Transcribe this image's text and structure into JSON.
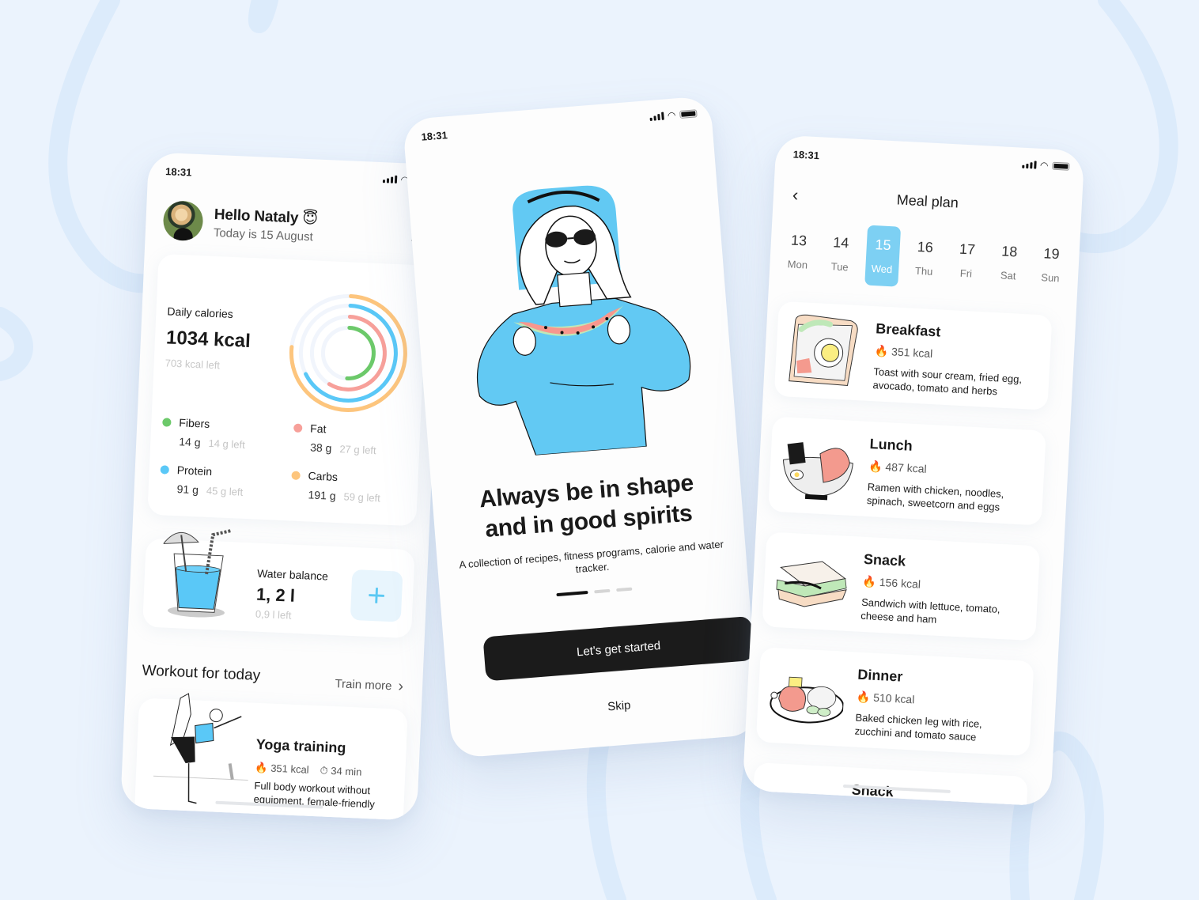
{
  "status_bar": {
    "time": "18:31"
  },
  "home": {
    "greeting": "Hello Nataly",
    "greeting_emoji": "😇",
    "date_line": "Today is 15 August",
    "daily_calories": {
      "label": "Daily calories",
      "value": "1034 kcal",
      "remaining": "703 kcal left"
    },
    "macros": [
      {
        "name": "Fibers",
        "amount": "14 g",
        "remaining": "14 g left",
        "color": "#6cc96a",
        "progress": 0.5
      },
      {
        "name": "Fat",
        "amount": "38 g",
        "remaining": "27 g left",
        "color": "#f7a09a",
        "progress": 0.58
      },
      {
        "name": "Protein",
        "amount": "91 g",
        "remaining": "45 g left",
        "color": "#5ac8f7",
        "progress": 0.67
      },
      {
        "name": "Carbs",
        "amount": "191 g",
        "remaining": "59 g left",
        "color": "#fdc57d",
        "progress": 0.76
      }
    ],
    "water": {
      "label": "Water balance",
      "value": "1, 2 l",
      "remaining": "0,9 l left",
      "add_label": "+"
    },
    "workout_section": {
      "title": "Workout for today",
      "link": "Train more",
      "item": {
        "name": "Yoga training",
        "kcal": "351 kcal",
        "duration": "34 min",
        "description": "Full body workout without equipment, female-friendly"
      }
    }
  },
  "onboarding": {
    "headline_line1": "Always be in shape",
    "headline_line2": "and in good spirits",
    "subtitle": "A collection of recipes, fitness programs, calorie and water tracker.",
    "page_index": 1,
    "page_count": 3,
    "cta_label": "Let's get started",
    "skip_label": "Skip"
  },
  "meal_plan": {
    "title": "Meal plan",
    "days": [
      {
        "num": "13",
        "wd": "Mon",
        "selected": false
      },
      {
        "num": "14",
        "wd": "Tue",
        "selected": false
      },
      {
        "num": "15",
        "wd": "Wed",
        "selected": true
      },
      {
        "num": "16",
        "wd": "Thu",
        "selected": false
      },
      {
        "num": "17",
        "wd": "Fri",
        "selected": false
      },
      {
        "num": "18",
        "wd": "Sat",
        "selected": false
      },
      {
        "num": "19",
        "wd": "Sun",
        "selected": false
      }
    ],
    "meals": [
      {
        "name": "Breakfast",
        "kcal": "351 kcal",
        "description": "Toast with sour cream, fried egg, avocado, tomato and herbs",
        "icon": "toast-icon"
      },
      {
        "name": "Lunch",
        "kcal": "487 kcal",
        "description": "Ramen with chicken, noodles, spinach, sweetcorn and eggs",
        "icon": "ramen-icon"
      },
      {
        "name": "Snack",
        "kcal": "156 kcal",
        "description": "Sandwich with lettuce, tomato, cheese and ham",
        "icon": "sandwich-icon"
      },
      {
        "name": "Dinner",
        "kcal": "510 kcal",
        "description": "Baked chicken leg with rice, zucchini and tomato sauce",
        "icon": "chicken-plate-icon"
      },
      {
        "name": "Snack",
        "kcal": "",
        "description": "",
        "icon": "snack-icon"
      }
    ]
  },
  "colors": {
    "accent_blue": "#5ac8f7",
    "selected_day": "#7dd0f3",
    "cta_dark": "#1b1b1b",
    "background": "#ebf3fd"
  }
}
